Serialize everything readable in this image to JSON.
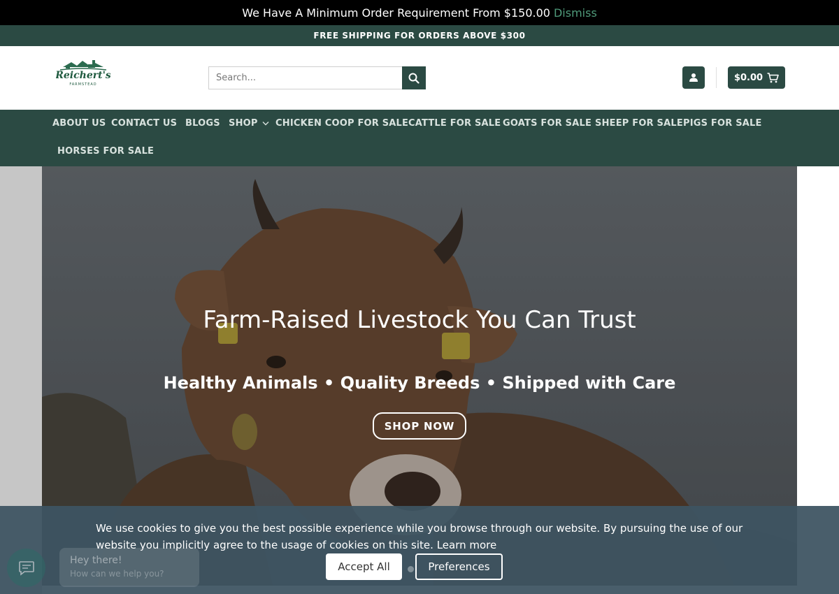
{
  "notice": {
    "text": "We Have A Minimum Order Requirement From $150.00",
    "dismiss_label": "Dismiss"
  },
  "shipping_banner": "FREE SHIPPING FOR ORDERS ABOVE $300",
  "header": {
    "logo_text": "Reichert's",
    "logo_subtext": "FARMSTEAD",
    "search_placeholder": "Search...",
    "cart_total": "$0.00"
  },
  "nav": {
    "items": [
      {
        "label": "ABOUT US"
      },
      {
        "label": "CONTACT US"
      },
      {
        "label": "BLOGS"
      },
      {
        "label": "SHOP"
      },
      {
        "label": "CHICKEN COOP FOR SALE"
      },
      {
        "label": "CATTLE FOR SALE"
      },
      {
        "label": "GOATS FOR SALE"
      },
      {
        "label": "SHEEP FOR SALE"
      },
      {
        "label": "PIGS FOR SALE"
      },
      {
        "label": "HORSES FOR SALE"
      }
    ]
  },
  "hero": {
    "title": "Farm-Raised Livestock You Can Trust",
    "subtitle": "Healthy Animals • Quality Breeds • Shipped with Care",
    "cta_label": "SHOP NOW"
  },
  "cookie": {
    "text": "We use cookies to give you the best possible experience while you browse through our website. By pursuing the use of our website you implicitly agree to the usage of cookies on this site.",
    "learn_more": "Learn more",
    "accept_label": "Accept All",
    "preferences_label": "Preferences"
  },
  "chat": {
    "greeting": "Hey there!",
    "prompt": "How can we help you?"
  },
  "colors": {
    "brand_green": "#2b4a43",
    "dismiss_link": "#4f9a7a",
    "cookie_bg": "#3e5462"
  }
}
